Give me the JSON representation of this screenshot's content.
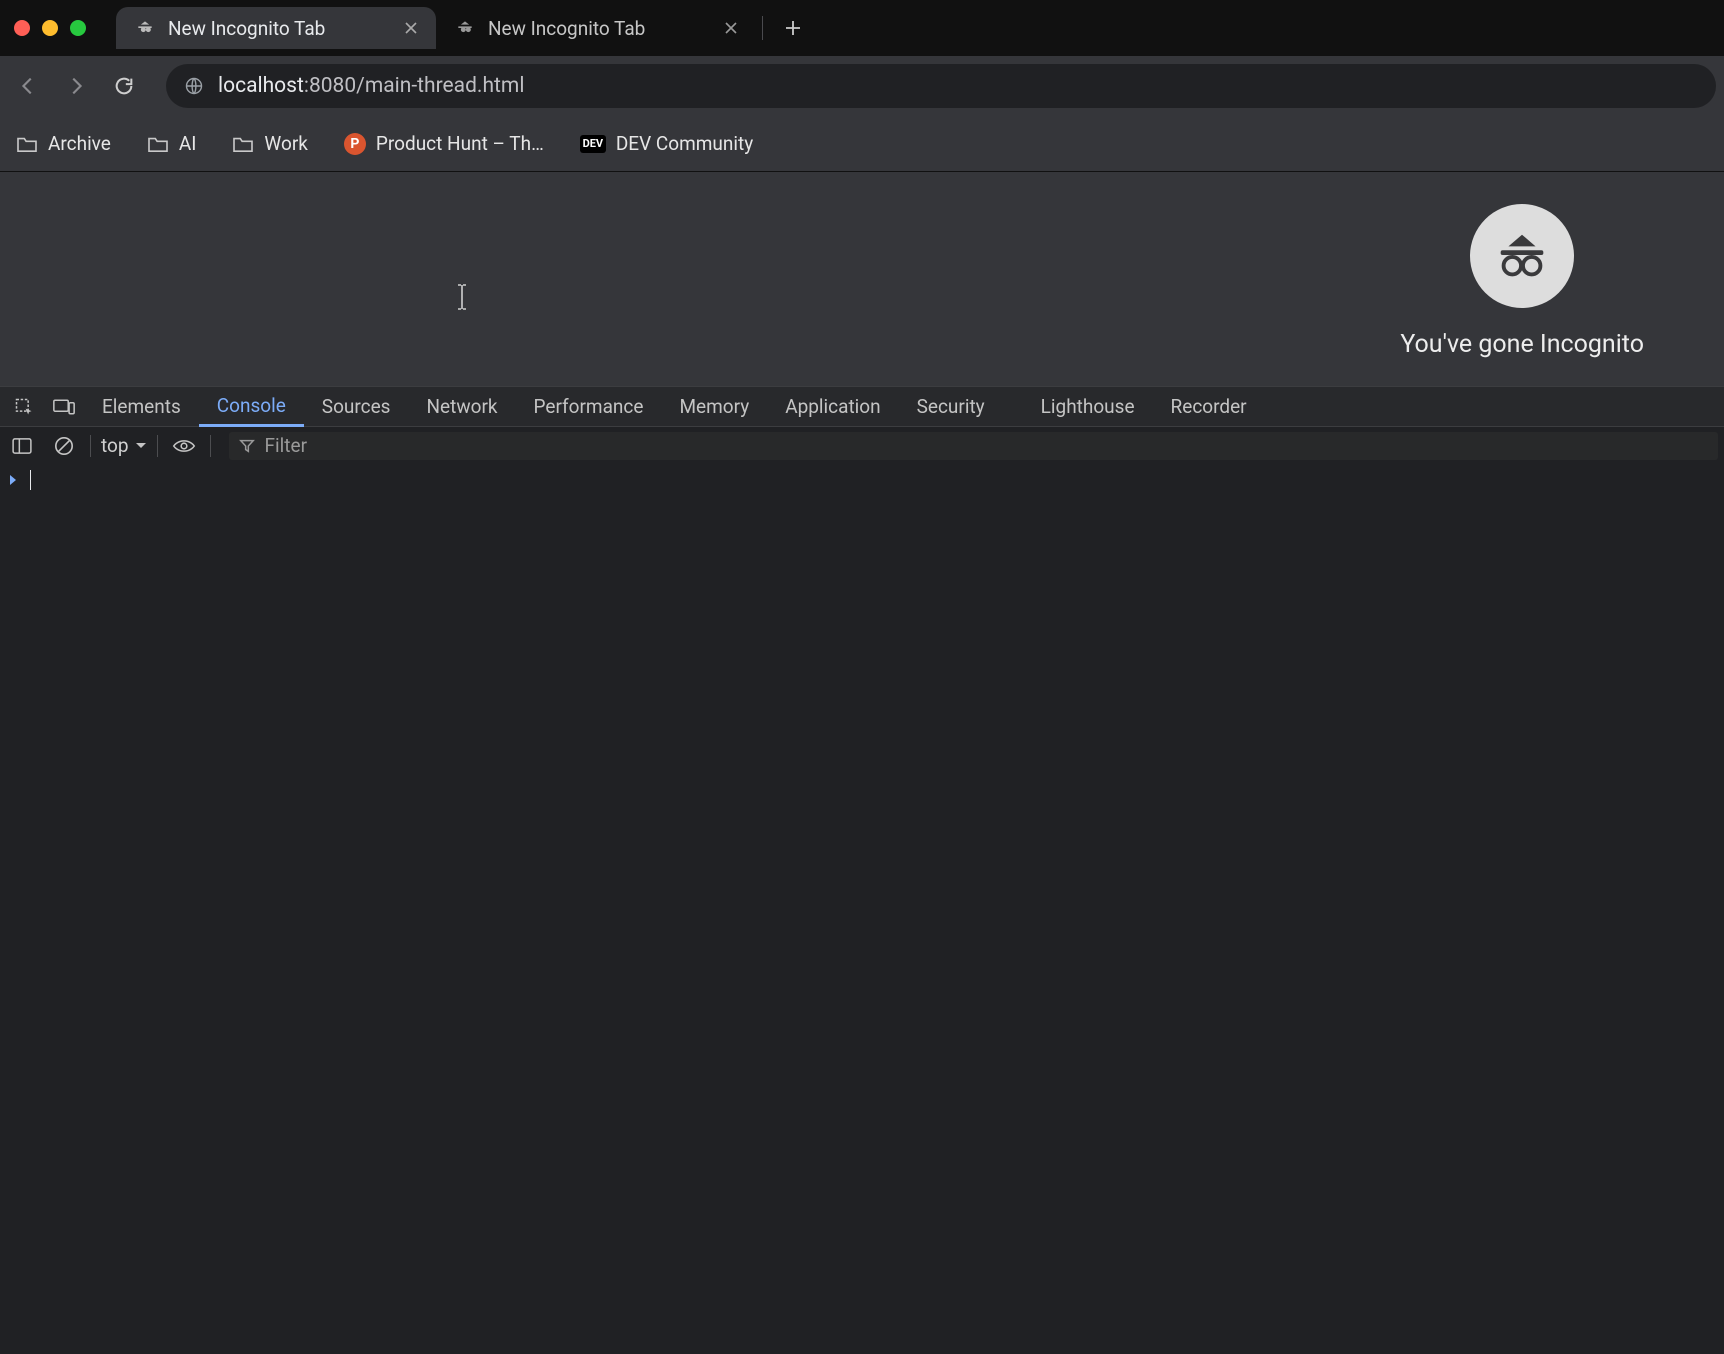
{
  "tabs": [
    {
      "title": "New Incognito Tab",
      "active": true
    },
    {
      "title": "New Incognito Tab",
      "active": false
    }
  ],
  "url": {
    "host": "localhost",
    "rest": ":8080/main-thread.html"
  },
  "bookmarks": [
    {
      "label": "Archive",
      "kind": "folder"
    },
    {
      "label": "AI",
      "kind": "folder"
    },
    {
      "label": "Work",
      "kind": "folder"
    },
    {
      "label": "Product Hunt – Th…",
      "kind": "ph"
    },
    {
      "label": "DEV Community",
      "kind": "dev"
    }
  ],
  "page": {
    "incognito_text": "You've gone Incognito"
  },
  "devtools": {
    "tabs": [
      "Elements",
      "Console",
      "Sources",
      "Network",
      "Performance",
      "Memory",
      "Application",
      "Security",
      "Lighthouse",
      "Recorder"
    ],
    "active": "Console",
    "context": "top",
    "filter_placeholder": "Filter"
  }
}
